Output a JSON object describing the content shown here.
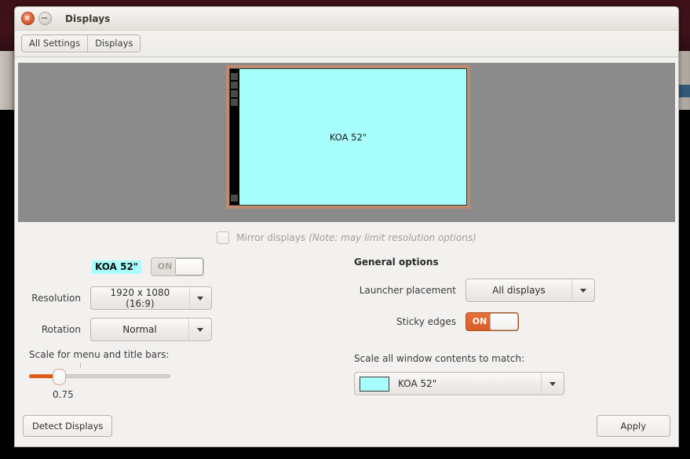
{
  "window": {
    "title": "Displays",
    "close_icon": "close-icon",
    "minimize_icon": "minimize-icon"
  },
  "toolbar": {
    "all_settings_label": "All Settings",
    "displays_label": "Displays"
  },
  "preview": {
    "monitor_label": "KOA 52\"",
    "screen_color": "#a8fdfd",
    "bezel_color": "#c08a6e",
    "canvas_color": "#8b8b8b",
    "launcher_icon_count": 5
  },
  "mirror": {
    "label": "Mirror displays",
    "note": "(Note: may limit resolution options)",
    "checked": false,
    "enabled": false
  },
  "display_settings": {
    "name": "KOA 52\"",
    "name_highlight_color": "#a8fdfd",
    "power_toggle_label": "ON",
    "power_toggle_enabled": false,
    "resolution_label": "Resolution",
    "resolution_value": "1920 x 1080 (16:9)",
    "rotation_label": "Rotation",
    "rotation_value": "Normal",
    "scale_caption": "Scale for menu and title bars:",
    "scale_value": "0.75"
  },
  "general_options": {
    "title": "General options",
    "launcher_placement_label": "Launcher placement",
    "launcher_placement_value": "All displays",
    "sticky_edges_label": "Sticky edges",
    "sticky_edges_toggle_label": "ON",
    "sticky_edges_on": true,
    "sticky_edges_color": "#de5b18",
    "scale_match_caption": "Scale all window contents to match:",
    "scale_match_value": "KOA 52\"",
    "scale_match_swatch_color": "#a8fdfd"
  },
  "footer": {
    "detect_label": "Detect Displays",
    "apply_label": "Apply"
  }
}
